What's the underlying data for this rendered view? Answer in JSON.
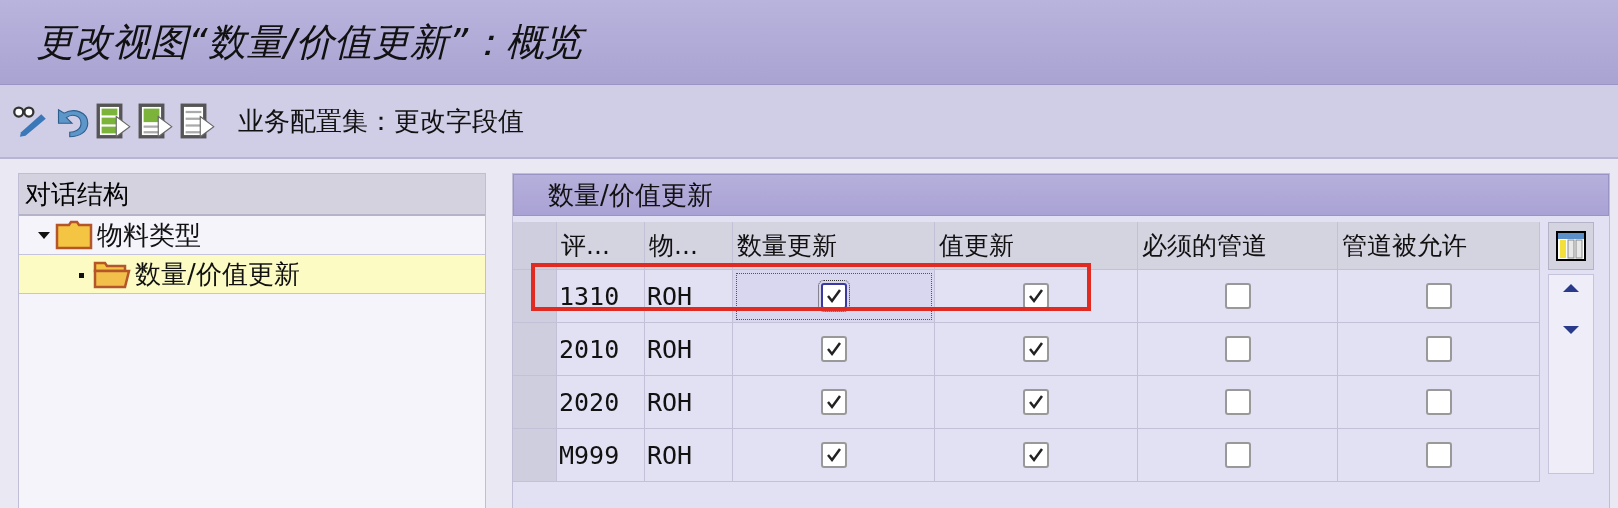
{
  "window": {
    "title": "更改视图“数量/价值更新”：概览"
  },
  "toolbar": {
    "buttons": [
      {
        "kind": "glasses-pen"
      },
      {
        "kind": "undo"
      },
      {
        "kind": "doc-green"
      },
      {
        "kind": "doc-half"
      },
      {
        "kind": "doc-grey"
      }
    ],
    "label": "业务配置集：更改字段值"
  },
  "sidebar": {
    "title": "对话结构",
    "items": [
      {
        "label": "物料类型",
        "expanded": true,
        "selected": false,
        "children": [
          {
            "label": "数量/价值更新",
            "expanded": false,
            "selected": true
          }
        ]
      }
    ]
  },
  "table": {
    "title": "数量/价值更新",
    "columns": [
      {
        "label": "评...",
        "kind": "text"
      },
      {
        "label": "物...",
        "kind": "text"
      },
      {
        "label": "数量更新",
        "kind": "check"
      },
      {
        "label": "值更新",
        "kind": "check"
      },
      {
        "label": "必须的管道",
        "kind": "check"
      },
      {
        "label": "管道被允许",
        "kind": "check"
      }
    ],
    "rows": [
      {
        "cells": [
          "1310",
          "ROH",
          {
            "checked": true,
            "focused": true
          },
          {
            "checked": true,
            "focused": false
          },
          {
            "checked": false,
            "focused": false
          },
          {
            "checked": false,
            "focused": false
          }
        ],
        "highlighted": true
      },
      {
        "cells": [
          "2010",
          "ROH",
          {
            "checked": true,
            "focused": false
          },
          {
            "checked": true,
            "focused": false
          },
          {
            "checked": false,
            "focused": false
          },
          {
            "checked": false,
            "focused": false
          }
        ],
        "highlighted": false
      },
      {
        "cells": [
          "2020",
          "ROH",
          {
            "checked": true,
            "focused": false
          },
          {
            "checked": true,
            "focused": false
          },
          {
            "checked": false,
            "focused": false
          },
          {
            "checked": false,
            "focused": false
          }
        ],
        "highlighted": false
      },
      {
        "cells": [
          "M999",
          "ROH",
          {
            "checked": true,
            "focused": false
          },
          {
            "checked": true,
            "focused": false
          },
          {
            "checked": false,
            "focused": false
          },
          {
            "checked": false,
            "focused": false
          }
        ],
        "highlighted": false
      }
    ]
  }
}
